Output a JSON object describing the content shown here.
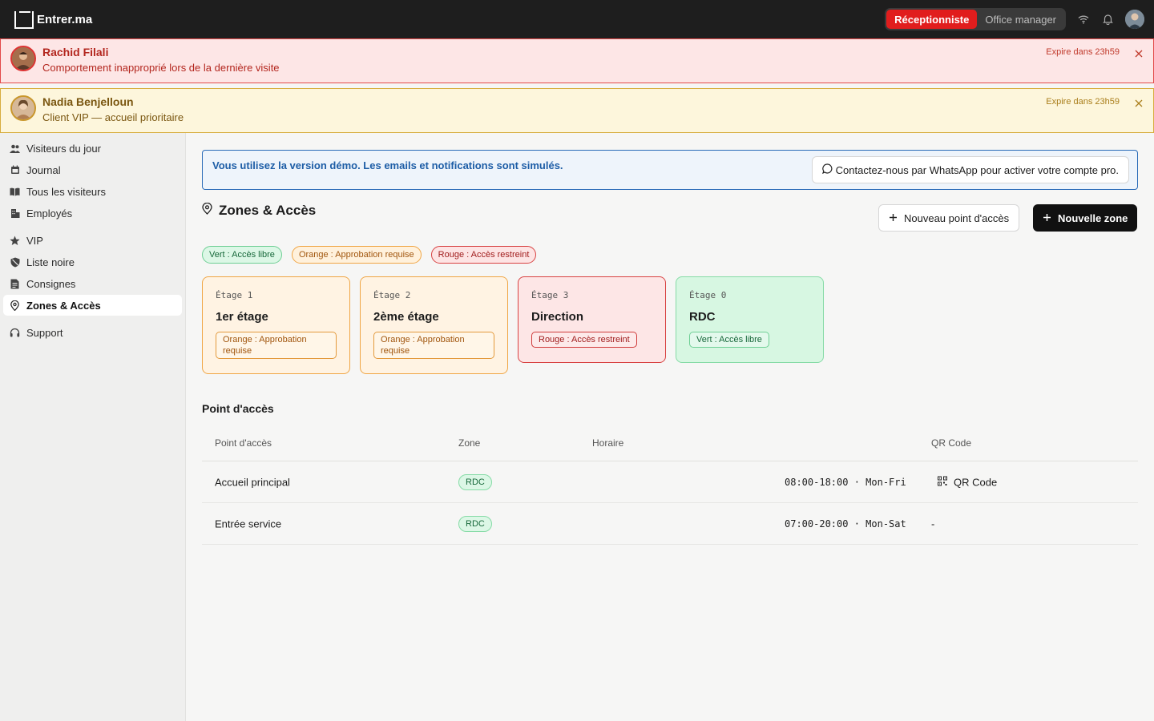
{
  "app": {
    "name": "Entrer.ma"
  },
  "roles": [
    {
      "label": "Réceptionniste",
      "active": true
    },
    {
      "label": "Office manager",
      "active": false
    }
  ],
  "alerts": [
    {
      "name": "Rachid Filali",
      "message": "Comportement inapproprié lors de la dernière visite",
      "expire": "Expire dans 23h59",
      "color": "#e34a4a"
    },
    {
      "name": "Nadia Benjelloun",
      "message": "Client VIP — accueil prioritaire",
      "expire": "Expire dans 23h59",
      "color": "#d7ad3e"
    }
  ],
  "sidebar": {
    "items": [
      {
        "label": "Visiteurs du jour",
        "icon": "users-icon"
      },
      {
        "label": "Journal",
        "icon": "calendar-icon"
      },
      {
        "label": "Tous les visiteurs",
        "icon": "book-icon"
      },
      {
        "label": "Employés",
        "icon": "building-icon"
      },
      {
        "label": "VIP",
        "icon": "star-icon"
      },
      {
        "label": "Liste noire",
        "icon": "shield-icon"
      },
      {
        "label": "Consignes",
        "icon": "document-icon"
      },
      {
        "label": "Zones & Accès",
        "icon": "location-pin-icon",
        "active": true
      },
      {
        "label": "Support",
        "icon": "headset-icon"
      }
    ]
  },
  "demo_banner": {
    "text": "Vous utilisez la version démo. Les emails et notifications sont simulés.",
    "button": "Contactez-nous par WhatsApp pour activer votre compte pro."
  },
  "page": {
    "title": "Zones & Accès",
    "new_access_point": "Nouveau point d'accès",
    "new_zone": "Nouvelle zone"
  },
  "legend": [
    {
      "label": "Vert : Accès libre",
      "color": "green"
    },
    {
      "label": "Orange : Approbation requise",
      "color": "orange"
    },
    {
      "label": "Rouge : Accès restreint",
      "color": "red"
    }
  ],
  "zones": [
    {
      "floor": "Étage 1",
      "name": "1er étage",
      "tag": "Orange : Approbation requise",
      "color": "orange"
    },
    {
      "floor": "Étage 2",
      "name": "2ème étage",
      "tag": "Orange : Approbation requise",
      "color": "orange"
    },
    {
      "floor": "Étage 3",
      "name": "Direction",
      "tag": "Rouge : Accès restreint",
      "color": "red"
    },
    {
      "floor": "Étage 0",
      "name": "RDC",
      "tag": "Vert : Accès libre",
      "color": "green"
    }
  ],
  "access_points": {
    "title": "Point d'accès",
    "columns": [
      "Point d'accès",
      "Zone",
      "Horaire",
      "QR Code"
    ],
    "rows": [
      {
        "name": "Accueil principal",
        "zone": "RDC",
        "schedule": "08:00-18:00 · Mon-Fri",
        "qr": "QR Code"
      },
      {
        "name": "Entrée service",
        "zone": "RDC",
        "schedule": "07:00-20:00 · Mon-Sat",
        "qr": "-"
      }
    ]
  }
}
